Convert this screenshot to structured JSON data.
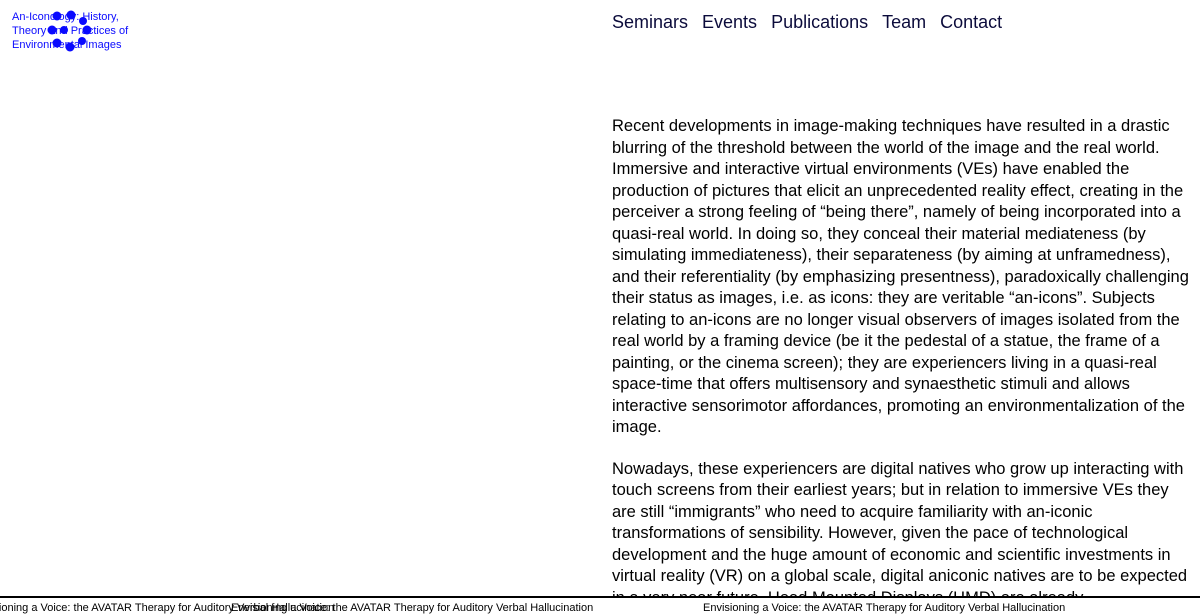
{
  "logo": {
    "lines": [
      "An-Iconology: History,",
      "Theory and Practices of",
      "Environmental Images"
    ],
    "color": "#0a0aff"
  },
  "nav": {
    "items": [
      "Seminars",
      "Events",
      "Publications",
      "Team",
      "Contact"
    ],
    "color": "#0b0b3b"
  },
  "content": {
    "paragraphs": [
      "Recent developments in image-making techniques have resulted in a drastic blurring of the threshold between the world of the image and the real world. Immersive and interactive virtual environments (VEs) have enabled the production of pictures that elicit an unprecedented reality effect, creating in the perceiver a strong feeling of “being there”, namely of being incorporated into a quasi-real world. In doing so, they conceal their material mediateness (by simulating immediateness), their separateness (by aiming at unframedness), and their referentiality (by emphasizing presentness), paradoxically challenging their status as images, i.e. as icons: they are veritable “an-icons”. Subjects relating to an-icons are no longer visual observers of images isolated from the real world by a framing device (be it the pedestal of a statue, the frame of a painting, or the cinema screen); they are experiencers living in a quasi-real space-time that offers multisensory and synaesthetic stimuli and allows interactive sensorimotor affordances, promoting an environmentalization of the image.",
      "Nowadays, these experiencers are digital natives who grow up interacting with touch screens from their earliest years; but in relation to immersive VEs they are still “immigrants” who need to acquire familiarity with an-iconic transformations of sensibility. However, given the pace of technological development and the huge amount of economic and scientific investments in virtual reality (VR) on a global scale, digital aniconic natives are to be expected in a very near future. Head Mounted Displays (HMD) are already"
    ]
  },
  "ticker": {
    "items": [
      "Envisioning a Voice: the AVATAR Therapy for Auditory Verbal Hallucination",
      "Envisioning a Voice: the AVATAR Therapy for Auditory Verbal Hallucination",
      "Envisioning a Voice: the AVATAR Therapy for Auditory Verbal Hallucination"
    ]
  }
}
